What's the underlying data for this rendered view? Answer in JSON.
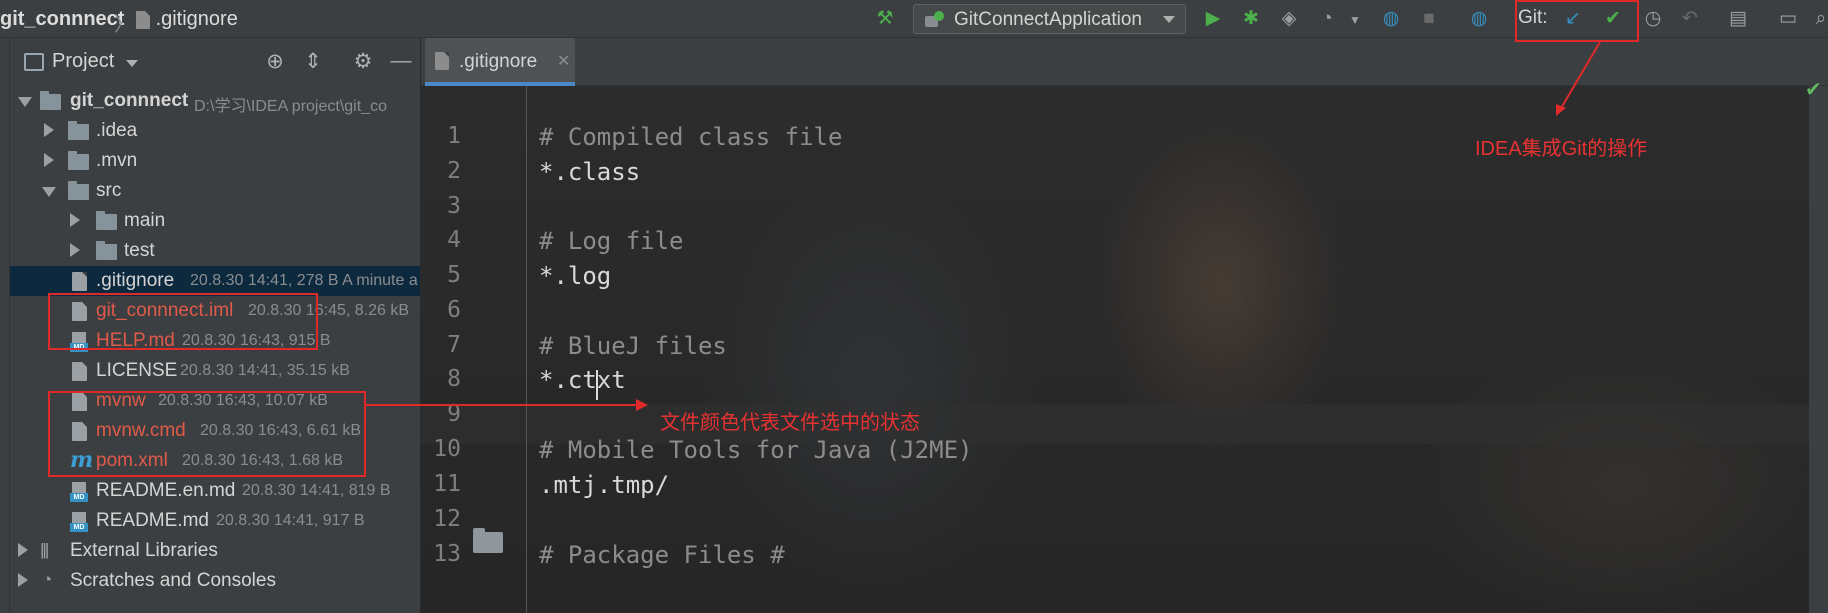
{
  "breadcrumb": {
    "project": "git_connnect",
    "file": ".gitignore"
  },
  "toolbar": {
    "run_config": "GitConnectApplication",
    "git_label": "Git:",
    "colors": {
      "run": "#4cb04c",
      "git_update": "#3592c4",
      "git_commit": "#4cb04c"
    }
  },
  "project_panel": {
    "title": "Project",
    "tree": [
      {
        "name": "git_connnect",
        "meta": "D:\\学习\\IDEA project\\git_co"
      },
      {
        "name": ".idea"
      },
      {
        "name": ".mvn"
      },
      {
        "name": "src"
      },
      {
        "name": "main"
      },
      {
        "name": "test"
      },
      {
        "name": ".gitignore",
        "meta": "20.8.30 14:41, 278 B A minute a"
      },
      {
        "name": "git_connnect.iml",
        "meta": "20.8.30 16:45, 8.26 kB"
      },
      {
        "name": "HELP.md",
        "meta": "20.8.30 16:43, 915 B"
      },
      {
        "name": "LICENSE",
        "meta": "20.8.30 14:41, 35.15 kB"
      },
      {
        "name": "mvnw",
        "meta": "20.8.30 16:43, 10.07 kB"
      },
      {
        "name": "mvnw.cmd",
        "meta": "20.8.30 16:43, 6.61 kB"
      },
      {
        "name": "pom.xml",
        "meta": "20.8.30 16:43, 1.68 kB"
      },
      {
        "name": "README.en.md",
        "meta": "20.8.30 14:41, 819 B"
      },
      {
        "name": "README.md",
        "meta": "20.8.30 14:41, 917 B"
      },
      {
        "name": "External Libraries"
      },
      {
        "name": "Scratches and Consoles"
      }
    ]
  },
  "editor": {
    "tab": ".gitignore",
    "lines": [
      {
        "num": "1",
        "text": "# Compiled class file"
      },
      {
        "num": "2",
        "text": "*.class"
      },
      {
        "num": "3",
        "text": ""
      },
      {
        "num": "4",
        "text": "# Log file"
      },
      {
        "num": "5",
        "text": "*.log"
      },
      {
        "num": "6",
        "text": ""
      },
      {
        "num": "7",
        "text": "# BlueJ files"
      },
      {
        "num": "8",
        "text": "*.ctxt"
      },
      {
        "num": "9",
        "text": ""
      },
      {
        "num": "10",
        "text": "# Mobile Tools for Java (J2ME)"
      },
      {
        "num": "11",
        "text": ".mtj.tmp/"
      },
      {
        "num": "12",
        "text": ""
      },
      {
        "num": "13",
        "text": "# Package Files #"
      }
    ]
  },
  "annotations": {
    "git_ops": "IDEA集成Git的操作",
    "file_color": "文件颜色代表文件选中的状态"
  }
}
